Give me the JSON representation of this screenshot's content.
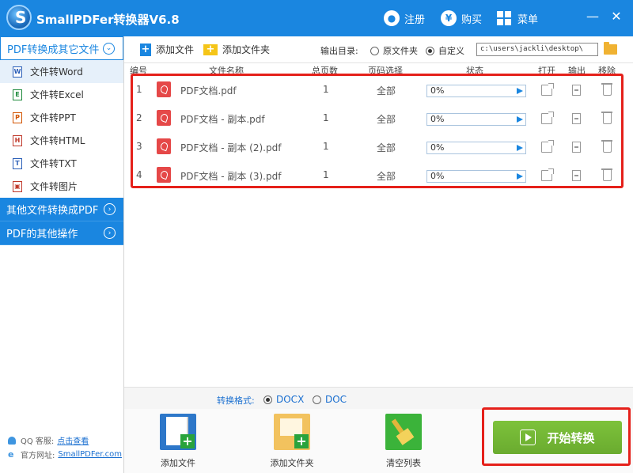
{
  "app": {
    "title": "SmallPDFer转换器V6.8",
    "logo_letter": "S",
    "register": "注册",
    "buy": "购买",
    "menu": "菜单",
    "minimize": "—",
    "close": "✕"
  },
  "sidebar": {
    "group1": "PDF转换成其它文件",
    "items": [
      {
        "label": "文件转Word",
        "icon": "W",
        "color": "#2b5fb8"
      },
      {
        "label": "文件转Excel",
        "icon": "E",
        "color": "#1e8a3c"
      },
      {
        "label": "文件转PPT",
        "icon": "P",
        "color": "#d35400"
      },
      {
        "label": "文件转HTML",
        "icon": "H",
        "color": "#c0392b"
      },
      {
        "label": "文件转TXT",
        "icon": "T",
        "color": "#2b5fb8"
      },
      {
        "label": "文件转图片",
        "icon": "▣",
        "color": "#c0392b"
      }
    ],
    "group2": "其他文件转换成PDF",
    "group3": "PDF的其他操作",
    "support_label": "QQ 客服:",
    "support_link": "点击查看",
    "site_label": "官方网址:",
    "site_link": "SmallPDFer.com"
  },
  "toolbar": {
    "add_file": "添加文件",
    "add_folder": "添加文件夹",
    "output_label": "输出目录:",
    "radio_source": "原文件夹",
    "radio_custom": "自定义",
    "output_path": "c:\\users\\jackli\\desktop\\"
  },
  "table": {
    "headers": {
      "num": "编号",
      "name": "文件名称",
      "pages": "总页数",
      "range": "页码选择",
      "status": "状态",
      "open": "打开",
      "output": "输出",
      "remove": "移除"
    },
    "rows": [
      {
        "num": "1",
        "name": "PDF文档.pdf",
        "pages": "1",
        "range": "全部",
        "progress": "0%"
      },
      {
        "num": "2",
        "name": "PDF文档 - 副本.pdf",
        "pages": "1",
        "range": "全部",
        "progress": "0%"
      },
      {
        "num": "3",
        "name": "PDF文档 - 副本 (2).pdf",
        "pages": "1",
        "range": "全部",
        "progress": "0%"
      },
      {
        "num": "4",
        "name": "PDF文档 - 副本 (3).pdf",
        "pages": "1",
        "range": "全部",
        "progress": "0%"
      }
    ]
  },
  "format": {
    "label": "转换格式:",
    "docx": "DOCX",
    "doc": "DOC",
    "selected": "DOCX"
  },
  "bottom": {
    "add_file": "添加文件",
    "add_folder": "添加文件夹",
    "clear": "清空列表",
    "start": "开始转换"
  },
  "colors": {
    "accent": "#1a86e0",
    "start_green": "#6aab2f",
    "highlight_red": "#e5201a",
    "pdf_red": "#e54848"
  }
}
